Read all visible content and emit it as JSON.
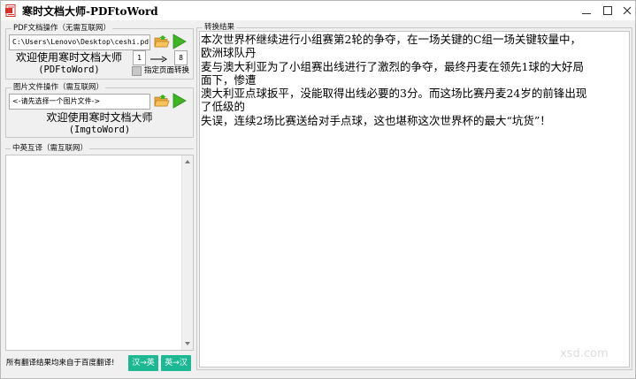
{
  "window": {
    "title": "寒时文档大师-PDFtoWord",
    "controls": [
      "minimize",
      "maximize",
      "close"
    ]
  },
  "pdf_group": {
    "label": "PDF文档操作（无需互联网）",
    "path_value": "C:\\Users\\Lenovo\\Desktop\\ceshi.pdf",
    "welcome_line1": "欢迎使用寒时文档大师",
    "welcome_line2": "(PDFtoWord)",
    "page_from": "1",
    "page_to": "8",
    "page_range_checkbox_label": "指定页面转换",
    "page_range_checked": false
  },
  "image_group": {
    "label": "图片文件操作（需互联网）",
    "path_placeholder": "<-请先选择一个图片文件->",
    "welcome_line1": "欢迎使用寒时文档大师",
    "welcome_line2": "(ImgtoWord)"
  },
  "translate_group": {
    "label": "中英互译（需互联网）",
    "input_value": "",
    "footer_note": "所有翻译结果均来自于百度翻译!",
    "cn_to_en_label": "汉→英",
    "en_to_cn_label": "英→汉"
  },
  "result_group": {
    "label": "转换结果",
    "lines": [
      "本次世界杯继续进行小组赛第2轮的争夺，在一场关键的C组一场关键较量中，",
      "欧洲球队丹",
      "麦与澳大利亚为了小组赛出线进行了激烈的争夺，最终丹麦在领先1球的大好局",
      "面下，惨遭",
      "澳大利亚点球扳平，没能取得出线必要的3分。而这场比赛丹麦24岁的前锋出现",
      "了低级的",
      "失误，连续2场比赛送给对手点球，这也堪称这次世界杯的最大“坑货”！"
    ]
  },
  "watermark": "xsd.com",
  "colors": {
    "accent_teal": "#1cb893",
    "play_green": "#3cb521",
    "folder_orange": "#f2a33a",
    "app_icon_red": "#d9302c"
  },
  "icons": {
    "app": "document-app-icon",
    "folder": "open-folder-icon",
    "play": "play-icon",
    "arrow": "right-arrow-icon"
  }
}
